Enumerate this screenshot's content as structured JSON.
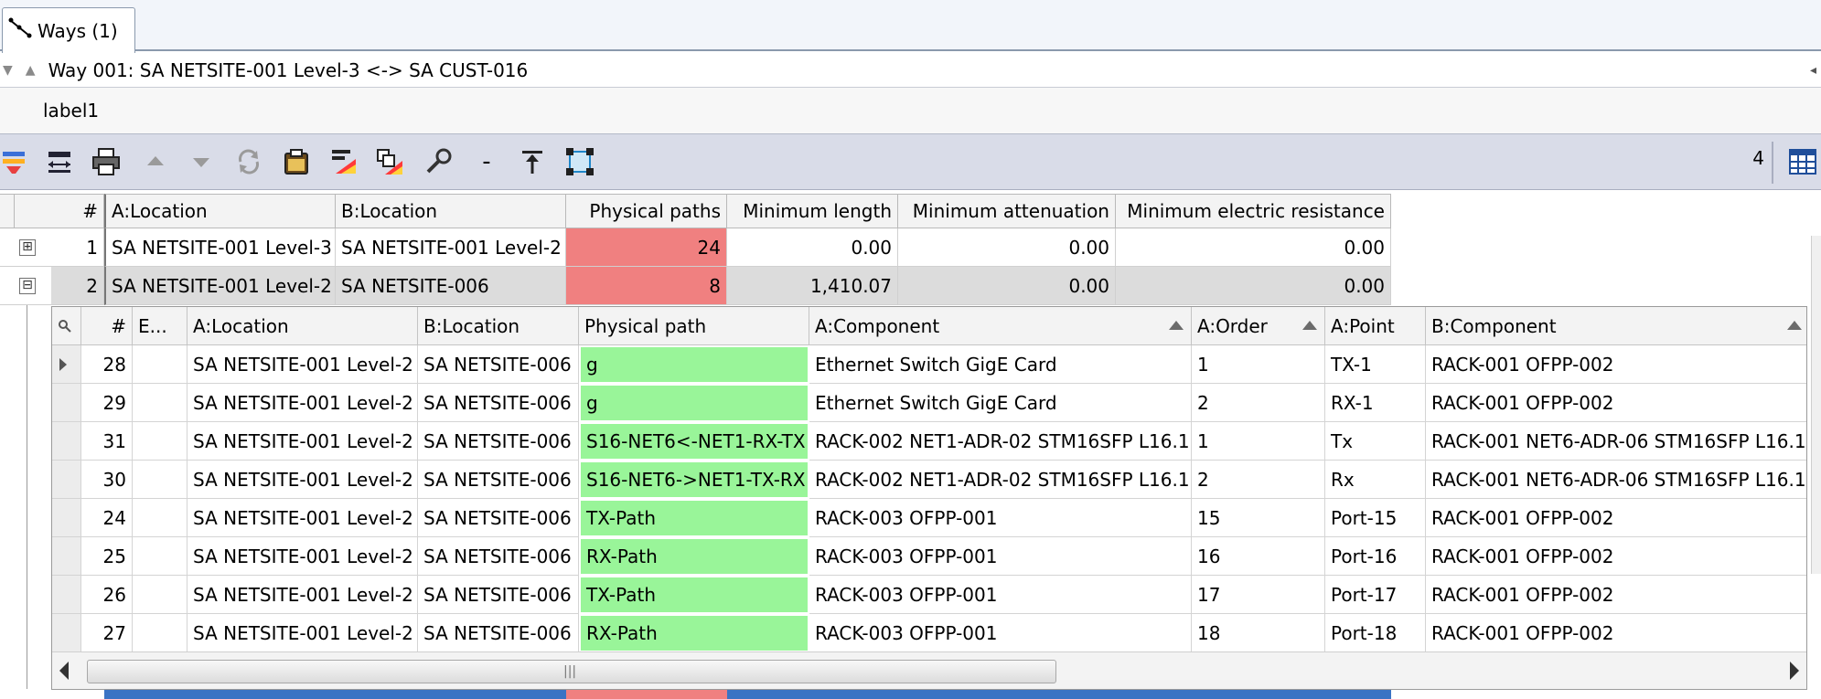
{
  "tabs": [
    {
      "label": "Ways (1)"
    }
  ],
  "way": {
    "title": "Way 001: SA NETSITE-001 Level-3 <-> SA CUST-016"
  },
  "label_row": {
    "text": "label1"
  },
  "toolbar": {
    "count": "4",
    "minus_label": "-"
  },
  "outer_grid": {
    "columns": [
      "#",
      "A:Location",
      "B:Location",
      "Physical paths",
      "Minimum length",
      "Minimum attenuation",
      "Minimum electric resistance"
    ],
    "rows": [
      {
        "num": "1",
        "a_location": "SA NETSITE-001 Level-3",
        "b_location": "SA NETSITE-001 Level-2",
        "physical_paths": "24",
        "min_length": "0.00",
        "min_attenuation": "0.00",
        "min_resistance": "0.00",
        "expander": "⊞"
      },
      {
        "num": "2",
        "a_location": "SA NETSITE-001 Level-2",
        "b_location": "SA NETSITE-006",
        "physical_paths": "8",
        "min_length": "1,410.07",
        "min_attenuation": "0.00",
        "min_resistance": "0.00",
        "expander": "⊟"
      }
    ]
  },
  "detail_grid": {
    "columns": [
      "#",
      "E...",
      "A:Location",
      "B:Location",
      "Physical path",
      "A:Component",
      "A:Order",
      "A:Point",
      "B:Component"
    ],
    "rows": [
      {
        "num": "28",
        "a_location": "SA NETSITE-001 Level-2",
        "b_location": "SA NETSITE-006",
        "path": "g",
        "a_component": "Ethernet Switch GigE Card",
        "a_order": "1",
        "a_point": "TX-1",
        "b_component": "RACK-001 OFPP-002"
      },
      {
        "num": "29",
        "a_location": "SA NETSITE-001 Level-2",
        "b_location": "SA NETSITE-006",
        "path": "g",
        "a_component": "Ethernet Switch GigE Card",
        "a_order": "2",
        "a_point": "RX-1",
        "b_component": "RACK-001 OFPP-002"
      },
      {
        "num": "31",
        "a_location": "SA NETSITE-001 Level-2",
        "b_location": "SA NETSITE-006",
        "path": "S16-NET6<-NET1-RX-TX",
        "a_component": "RACK-002 NET1-ADR-02 STM16SFP L16.1",
        "a_order": "1",
        "a_point": "Tx",
        "b_component": "RACK-001 NET6-ADR-06 STM16SFP L16.1"
      },
      {
        "num": "30",
        "a_location": "SA NETSITE-001 Level-2",
        "b_location": "SA NETSITE-006",
        "path": "S16-NET6->NET1-TX-RX",
        "a_component": "RACK-002 NET1-ADR-02 STM16SFP L16.1",
        "a_order": "2",
        "a_point": "Rx",
        "b_component": "RACK-001 NET6-ADR-06 STM16SFP L16.1"
      },
      {
        "num": "24",
        "a_location": "SA NETSITE-001 Level-2",
        "b_location": "SA NETSITE-006",
        "path": "TX-Path",
        "a_component": "RACK-003 OFPP-001",
        "a_order": "15",
        "a_point": "Port-15",
        "b_component": "RACK-001 OFPP-002"
      },
      {
        "num": "25",
        "a_location": "SA NETSITE-001 Level-2",
        "b_location": "SA NETSITE-006",
        "path": "RX-Path",
        "a_component": "RACK-003 OFPP-001",
        "a_order": "16",
        "a_point": "Port-16",
        "b_component": "RACK-001 OFPP-002"
      },
      {
        "num": "26",
        "a_location": "SA NETSITE-001 Level-2",
        "b_location": "SA NETSITE-006",
        "path": "TX-Path",
        "a_component": "RACK-003 OFPP-001",
        "a_order": "17",
        "a_point": "Port-17",
        "b_component": "RACK-001 OFPP-002"
      },
      {
        "num": "27",
        "a_location": "SA NETSITE-001 Level-2",
        "b_location": "SA NETSITE-006",
        "path": "RX-Path",
        "a_component": "RACK-003 OFPP-001",
        "a_order": "18",
        "a_point": "Port-18",
        "b_component": "RACK-001 OFPP-002"
      }
    ]
  },
  "colors": {
    "red_cell": "#f08080",
    "green_cell": "#99f599",
    "toolbar_bg": "#d9dce8",
    "accent_blue": "#3a73c4"
  }
}
